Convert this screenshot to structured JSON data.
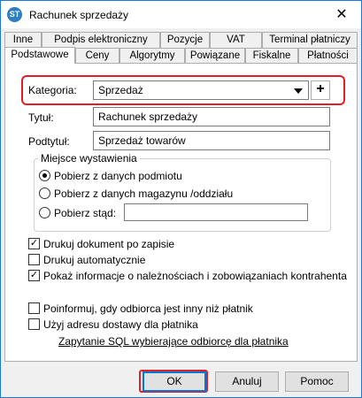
{
  "window": {
    "title": "Rachunek sprzedaży",
    "app_icon_text": "ST"
  },
  "tabs_row1": [
    "Inne",
    "Podpis elektroniczny",
    "Pozycje",
    "VAT",
    "Terminal płatniczy"
  ],
  "tabs_row2": [
    "Podstawowe",
    "Ceny",
    "Algorytmy",
    "Powiązane",
    "Fiskalne",
    "Płatności"
  ],
  "active_tab": "Podstawowe",
  "form": {
    "kategoria_label": "Kategoria:",
    "kategoria_value": "Sprzedaż",
    "plus_label": "+",
    "tytul_label": "Tytuł:",
    "tytul_value": "Rachunek sprzedaży",
    "podtytul_label": "Podtytuł:",
    "podtytul_value": "Sprzedaż towarów"
  },
  "miejsce": {
    "title": "Miejsce wystawienia",
    "option1": "Pobierz z danych podmiotu",
    "option2": "Pobierz z danych magazynu /oddziału",
    "option3": "Pobierz stąd:",
    "option3_value": "",
    "selected": 1
  },
  "checks": {
    "drukuj_po_zapisie": "Drukuj dokument po zapisie",
    "drukuj_po_zapisie_checked": true,
    "drukuj_automatycznie": "Drukuj automatycznie",
    "drukuj_automatycznie_checked": false,
    "pokaz_informacje": "Pokaż informacje o należnościach i zobowiązaniach kontrahenta",
    "pokaz_informacje_checked": true,
    "poinformuj": "Poinformuj, gdy odbiorca jest inny niż płatnik",
    "poinformuj_checked": false,
    "uzyj_adresu": "Użyj adresu dostawy dla płatnika",
    "uzyj_adresu_checked": false
  },
  "link": {
    "sql_label": "Zapytanie SQL wybierające odbiorcę dla płatnika"
  },
  "buttons": {
    "ok": "OK",
    "anuluj": "Anuluj",
    "pomoc": "Pomoc"
  },
  "colors": {
    "highlight": "#e21f26",
    "accent": "#0078d7"
  },
  "icons": {
    "close": "close-icon",
    "dropdown": "chevron-down-icon",
    "check": "checkmark-icon"
  }
}
